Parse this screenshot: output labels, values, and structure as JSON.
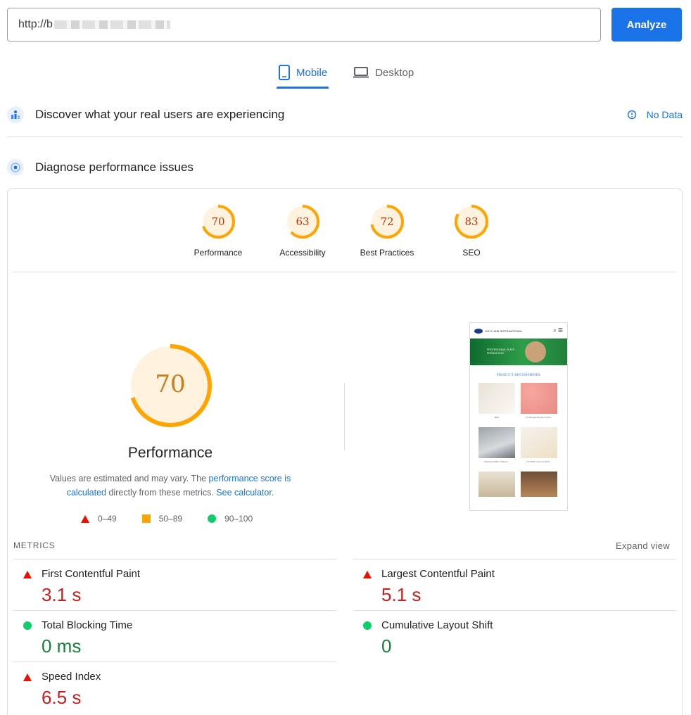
{
  "search": {
    "url_value": "http://b",
    "analyze_label": "Analyze"
  },
  "tabs": [
    {
      "label": "Mobile",
      "active": true
    },
    {
      "label": "Desktop",
      "active": false
    }
  ],
  "field_section": {
    "title": "Discover what your real users are experiencing",
    "status": "No Data"
  },
  "lab_section": {
    "title": "Diagnose performance issues"
  },
  "categories": [
    {
      "label": "Performance",
      "score": "70"
    },
    {
      "label": "Accessibility",
      "score": "63"
    },
    {
      "label": "Best Practices",
      "score": "72"
    },
    {
      "label": "SEO",
      "score": "83"
    }
  ],
  "performance": {
    "score": "70",
    "title": "Performance",
    "desc_prefix": "Values are estimated and may vary. The ",
    "desc_link1": "performance score is calculated",
    "desc_mid": " directly from these metrics. ",
    "desc_link2": "See calculator."
  },
  "legend": [
    {
      "range": "0–49"
    },
    {
      "range": "50–89"
    },
    {
      "range": "90–100"
    }
  ],
  "metrics": {
    "header": "METRICS",
    "expand_label": "Expand view",
    "items": [
      {
        "name": "First Contentful Paint",
        "value": "3.1 s",
        "status": "poor"
      },
      {
        "name": "Largest Contentful Paint",
        "value": "5.1 s",
        "status": "poor"
      },
      {
        "name": "Total Blocking Time",
        "value": "0 ms",
        "status": "good"
      },
      {
        "name": "Cumulative Layout Shift",
        "value": "0",
        "status": "good"
      },
      {
        "name": "Speed Index",
        "value": "6.5 s",
        "status": "poor"
      }
    ]
  },
  "screenshot": {
    "brand": "LINYI HAIB INTERNATIONAL",
    "banner_text": "PROFESSIONAL PLATE PRODUCTION",
    "section_title": "PRODUCT RECOMMENDS",
    "products": [
      "MDF",
      "UV Rosewood Faux Finish...",
      "Melamine MDF / Melami...",
      "UV White Commercial Pl..."
    ]
  },
  "colors": {
    "accent": "#1a73e8",
    "average": "#ffa400",
    "poor": "#eb0f00",
    "good": "#0cce6b"
  }
}
